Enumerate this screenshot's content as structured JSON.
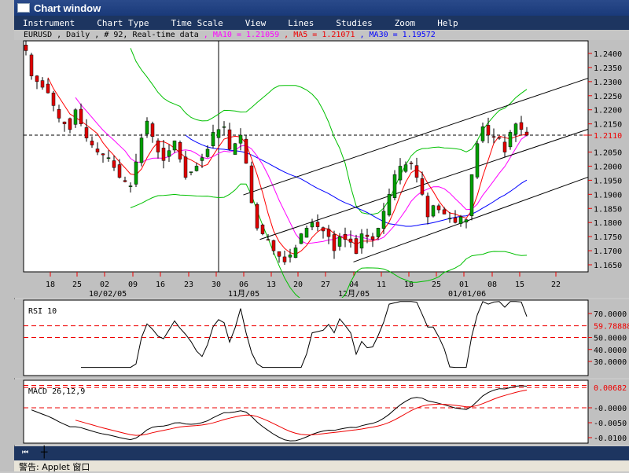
{
  "window": {
    "title": "Chart window"
  },
  "menu": [
    "Instrument",
    "Chart Type",
    "Time Scale",
    "View",
    "Lines",
    "Studies",
    "Zoom",
    "Help"
  ],
  "info": {
    "symbol": "EURUSD , Daily , # 92, Real-time data",
    "ma10": ", MA10 = 1.21059",
    "ma5": ", MA5 = 1.21071",
    "ma30": ", MA30 = 1.19572"
  },
  "colors": {
    "ma10": "#ff00ff",
    "ma5": "#ff0000",
    "ma30": "#0000ff",
    "bollinger": "#00c000",
    "up": "#00a000",
    "down": "#e00000"
  },
  "price_axis": {
    "ticks": [
      "1.2400",
      "1.2350",
      "1.2300",
      "1.2250",
      "1.2200",
      "1.2150",
      "1.2050",
      "1.2000",
      "1.1950",
      "1.1900",
      "1.1850",
      "1.1800",
      "1.1750",
      "1.1700",
      "1.1650"
    ],
    "current": "1.2110",
    "current_value": 1.211
  },
  "date_axis": {
    "days": [
      "18",
      "25",
      "02",
      "09",
      "16",
      "23",
      "30",
      "06",
      "13",
      "20",
      "27",
      "04",
      "11",
      "18",
      "25",
      "01",
      "08",
      "15",
      "22"
    ],
    "months": [
      "10/02/05",
      "11月/05",
      "12月/05",
      "01/01/06"
    ]
  },
  "price_path": [
    [
      0,
      1.241
    ],
    [
      1,
      1.232
    ],
    [
      4,
      1.226
    ],
    [
      6,
      1.217
    ],
    [
      8,
      1.213
    ],
    [
      9,
      1.22
    ],
    [
      11,
      1.21
    ],
    [
      13,
      1.205
    ],
    [
      15,
      1.203
    ],
    [
      17,
      1.196
    ],
    [
      19,
      1.193
    ],
    [
      21,
      1.21
    ],
    [
      22,
      1.216
    ],
    [
      24,
      1.205
    ],
    [
      25,
      1.202
    ],
    [
      27,
      1.209
    ],
    [
      29,
      1.196
    ],
    [
      31,
      1.2
    ],
    [
      33,
      1.206
    ],
    [
      34,
      1.212
    ],
    [
      36,
      1.214
    ],
    [
      37,
      1.206
    ],
    [
      38,
      1.208
    ],
    [
      39,
      1.211
    ],
    [
      40,
      1.201
    ],
    [
      41,
      1.187
    ],
    [
      42,
      1.178
    ],
    [
      44,
      1.174
    ],
    [
      45,
      1.17
    ],
    [
      46,
      1.168
    ],
    [
      47,
      1.166
    ],
    [
      49,
      1.171
    ],
    [
      50,
      1.176
    ],
    [
      52,
      1.18
    ],
    [
      54,
      1.177
    ],
    [
      55,
      1.175
    ],
    [
      56,
      1.17
    ],
    [
      57,
      1.175
    ],
    [
      59,
      1.173
    ],
    [
      60,
      1.169
    ],
    [
      61,
      1.176
    ],
    [
      63,
      1.174
    ],
    [
      64,
      1.178
    ],
    [
      65,
      1.184
    ],
    [
      66,
      1.19
    ],
    [
      67,
      1.197
    ],
    [
      68,
      1.2
    ],
    [
      70,
      1.201
    ],
    [
      71,
      1.196
    ],
    [
      72,
      1.19
    ],
    [
      73,
      1.182
    ],
    [
      74,
      1.186
    ],
    [
      76,
      1.183
    ],
    [
      78,
      1.18
    ],
    [
      79,
      1.182
    ],
    [
      80,
      1.181
    ],
    [
      81,
      1.197
    ],
    [
      82,
      1.208
    ],
    [
      83,
      1.214
    ],
    [
      84,
      1.211
    ],
    [
      86,
      1.21
    ],
    [
      87,
      1.205
    ],
    [
      88,
      1.212
    ],
    [
      89,
      1.215
    ],
    [
      90,
      1.213
    ],
    [
      91,
      1.211
    ]
  ],
  "channel": [
    {
      "from": [
        39.5,
        1.1898
      ],
      "to": [
        102,
        1.2311
      ]
    },
    {
      "from": [
        42.5,
        1.174
      ],
      "to": [
        102,
        1.213
      ]
    },
    {
      "from": [
        59.5,
        1.166
      ],
      "to": [
        102,
        1.196
      ]
    }
  ],
  "rsi": {
    "label": "RSI 10",
    "ticks": [
      "70.0000",
      "50.0000",
      "40.0000",
      "30.0000"
    ],
    "current": "59.78888"
  },
  "macd": {
    "label": "MACD 26,12,9",
    "ticks": [
      "-0.0000",
      "-0.0050",
      "-0.0100"
    ],
    "current": "0.00682"
  },
  "status": "警告: Applet 窗口"
}
